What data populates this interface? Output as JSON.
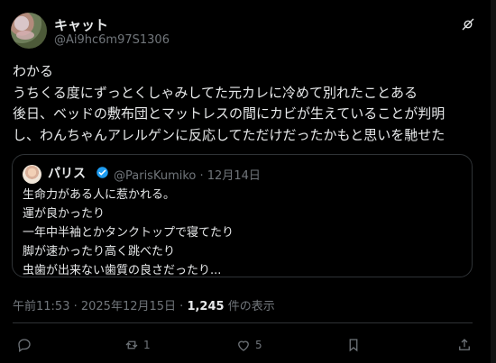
{
  "author": {
    "name": "キャット",
    "handle": "@Ai9hc6m97S1306"
  },
  "tweet": {
    "text": "わかる\nうちくる度にずっとくしゃみしてた元カレに冷めて別れたことある\n後日、ベッドの敷布団とマットレスの間にカビが生えていることが判明\nし、わんちゃんアレルゲンに反応してただけだったかもと思いを馳せた"
  },
  "quote": {
    "name": "パリス",
    "handle": "@ParisKumiko",
    "date": "12月14日",
    "text": "生命力がある人に惹かれる。\n運が良かったり\n一年中半袖とかタンクトップで寝てたり\n脚が速かったり高く跳べたり\n虫歯が出来ない歯質の良さだったり..."
  },
  "meta": {
    "timestamp": "午前11:53 · 2025年12月15日 · ",
    "views": "1,245",
    "views_label": " 件の表示"
  },
  "actions": {
    "reposts": "1",
    "likes": "5"
  },
  "icons": [
    "tag-slash-icon",
    "verified-badge-icon",
    "reply-icon",
    "repost-icon",
    "like-icon",
    "bookmark-icon",
    "share-icon"
  ],
  "colors": {
    "background": "#000000",
    "text": "#e7e9ea",
    "secondary": "#71767b",
    "verified": "#1d9bf0"
  }
}
